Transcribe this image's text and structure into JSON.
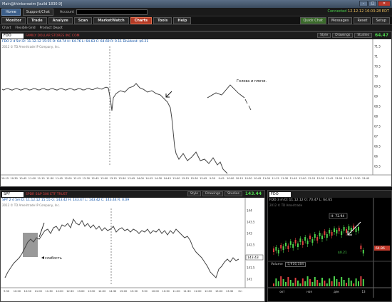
{
  "window": {
    "title": "Main@thinkorswim [build 1830.9]"
  },
  "topbar": {
    "home": "Home",
    "support": "Support/Chat",
    "account_label": "Account",
    "connection_status": "Connected",
    "timestamp": "12.12.12 16:03:28 EDT"
  },
  "tabs": [
    "Monitor",
    "Trade",
    "Analyze",
    "Scan",
    "MarketWatch",
    "Charts",
    "Tools",
    "Help"
  ],
  "active_tab": "Charts",
  "top_right_buttons": [
    "Quick Chat",
    "Messages",
    "Reset",
    "Setup"
  ],
  "toolbar": [
    "Chart",
    "Flexible Grid",
    "Product Depot"
  ],
  "main_chart": {
    "symbol": "FDO",
    "description": "FAMILY DOLLAR STORES INC COM",
    "last": "64.47",
    "info": "FDO 2 d 5m   D: 11.12.12 15:55   O: 64.74   H: 64.76   L: 64.63   C: 64.69   R: 0.11   Dividend: $0.21",
    "copyright": "2012 © TD Ameritrade IP Company, Inc.",
    "buttons": [
      "Style",
      "Drawings",
      "Studies"
    ],
    "annotation": "Голова и плечи.",
    "y_ticks": [
      "71.5",
      "71",
      "70.5",
      "70",
      "69.5",
      "69",
      "68.5",
      "68",
      "67.5",
      "67",
      "66.5",
      "66",
      "65.5"
    ],
    "x_ticks": [
      "10:15",
      "10:30",
      "10:45",
      "11:00",
      "11:15",
      "11:30",
      "11:45",
      "12:00",
      "12:15",
      "12:30",
      "12:45",
      "13:00",
      "13:15",
      "13:30",
      "13:45",
      "14:00",
      "14:15",
      "14:30",
      "14:45",
      "15:00",
      "15:15",
      "15:30",
      "15:45",
      "9:30",
      "9:45",
      "10:00",
      "10:15",
      "10:30",
      "10:45",
      "11:00",
      "11:15",
      "11:30",
      "11:45",
      "12:00",
      "12:15",
      "12:30",
      "12:45",
      "13:00",
      "13:15",
      "13:30",
      "13:45"
    ]
  },
  "left_chart": {
    "symbol": "SPY",
    "description": "SPDR S&P 500 ETF TRUST",
    "last": "143.44",
    "info": "SPY 2 d 5m   D: 11.12.12 15:55   O: 143.42   H: 143.47   L: 143.42   C: 143.44   R: 0.09",
    "copyright": "2012 © TD Ameritrade IP Company, Inc.",
    "buttons": [
      "Style",
      "Drawings",
      "Studies"
    ],
    "annotation": "слабость",
    "price_label": "143.43",
    "y_ticks": [
      "144",
      "143.5",
      "143",
      "142.5",
      "142",
      "141.5",
      "141"
    ],
    "x_ticks": [
      "9:30",
      "10:00",
      "10:30",
      "11:00",
      "11:30",
      "12:00",
      "12:30",
      "13:00",
      "13:30",
      "14:00",
      "14:30",
      "15:00",
      "15:30",
      "9:30",
      "10:00",
      "10:30",
      "11:00",
      "11:30",
      "12:00",
      "12:30",
      "13:00",
      "13:30",
      "Оп"
    ]
  },
  "right_chart": {
    "symbol": "FDO",
    "info": "FDO 3 m D: 11.12.12   O: 70.47   L: 64.65",
    "copyright": "2012 © TD Ameritrade",
    "high_label": "H: 72.94",
    "low_label": "$0.21",
    "price_label": "64.86",
    "volume_label": "Volume",
    "volume_value": "5,916,184",
    "x_ticks": [
      "окт",
      "ноя",
      "дек",
      "13"
    ]
  }
}
